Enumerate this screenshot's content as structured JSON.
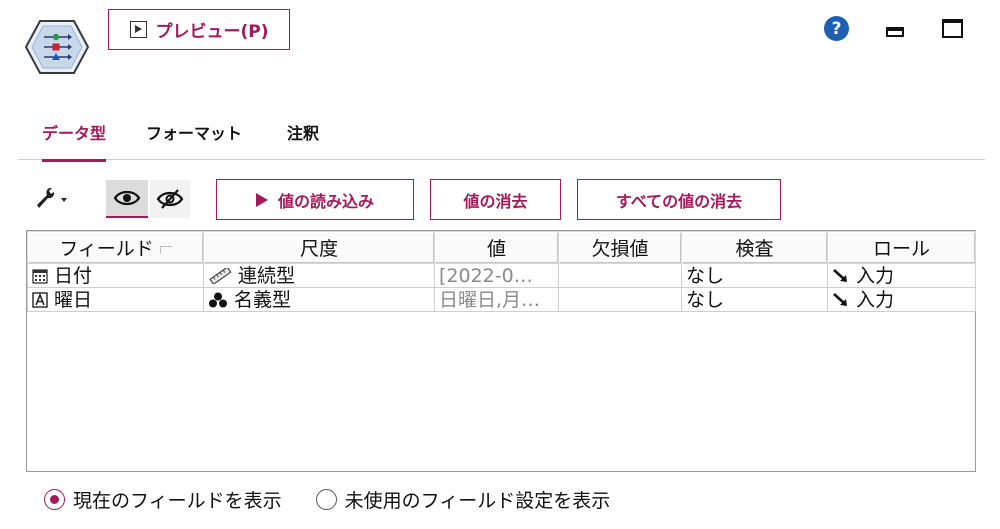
{
  "header": {
    "preview_label": "プレビュー(P)",
    "help_glyph": "?"
  },
  "tabs": [
    {
      "label": "データ型",
      "active": true
    },
    {
      "label": "フォーマット",
      "active": false
    },
    {
      "label": "注釈",
      "active": false
    }
  ],
  "toolbar": {
    "read_values_label": "値の読み込み",
    "clear_values_label": "値の消去",
    "clear_all_values_label": "すべての値の消去"
  },
  "grid": {
    "columns": [
      "フィールド",
      "尺度",
      "値",
      "欠損値",
      "検査",
      "ロール"
    ],
    "rows": [
      {
        "field": "日付",
        "field_icon": "calendar-icon",
        "measure": "連続型",
        "measure_icon": "ruler-icon",
        "values": "[2022-0…",
        "missing": "",
        "check": "なし",
        "role": "入力",
        "role_icon": "input-arrow-icon"
      },
      {
        "field": "曜日",
        "field_icon": "string-type-icon",
        "measure": "名義型",
        "measure_icon": "nominal-icon",
        "values": "日曜日,月…",
        "missing": "",
        "check": "なし",
        "role": "入力",
        "role_icon": "input-arrow-icon"
      }
    ]
  },
  "options": {
    "show_current_label": "現在のフィールドを表示",
    "show_unused_label": "未使用のフィールド設定を表示",
    "selected": "show_current"
  },
  "colors": {
    "accent": "#a3195b",
    "help_blue": "#1c5fb3"
  }
}
